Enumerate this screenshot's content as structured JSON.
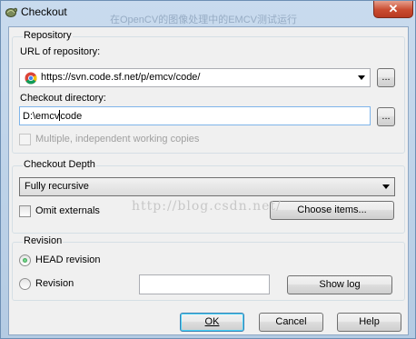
{
  "window": {
    "title": "Checkout",
    "background_title": "在OpenCV的图像处理中的EMCV测试运行",
    "close_label": "✕"
  },
  "repository": {
    "group_title": "Repository",
    "url_label": "URL of repository:",
    "url_value": "https://svn.code.sf.net/p/emcv/code/",
    "browse_label": "...",
    "dir_label": "Checkout directory:",
    "dir_value_before": "D:\\emcv",
    "dir_value_after": "code",
    "dir_browse_label": "...",
    "multiple_label": "Multiple, independent working copies"
  },
  "depth": {
    "group_title": "Checkout Depth",
    "selected": "Fully recursive",
    "omit_label": "Omit externals",
    "choose_label": "Choose items..."
  },
  "revision": {
    "group_title": "Revision",
    "head_label": "HEAD revision",
    "revision_label": "Revision",
    "revision_value": "",
    "show_log_label": "Show log"
  },
  "buttons": {
    "ok": "OK",
    "cancel": "Cancel",
    "help": "Help"
  },
  "watermark": "http://blog.csdn.net/",
  "colors": {
    "close_button": "#c94b30",
    "focus_border": "#7eb4ea",
    "radio_dot": "#1a7d2e"
  }
}
